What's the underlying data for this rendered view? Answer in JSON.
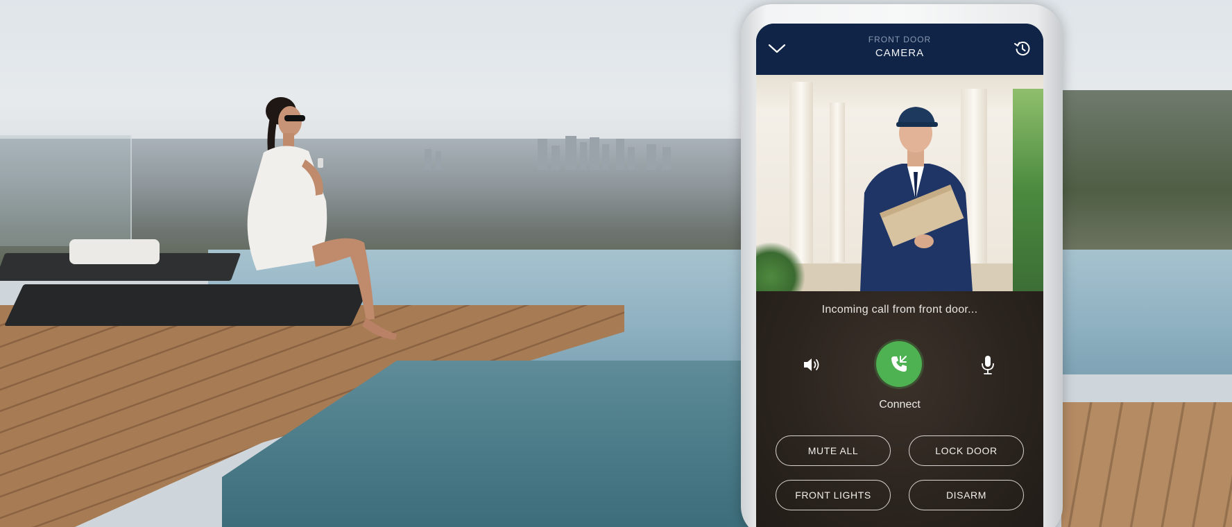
{
  "header": {
    "subtitle": "FRONT DOOR",
    "title": "CAMERA",
    "back_icon": "chevron-down-icon",
    "history_icon": "history-icon"
  },
  "call": {
    "status_text": "Incoming call from front door...",
    "connect_label": "Connect",
    "speaker_icon": "speaker-icon",
    "mic_icon": "microphone-icon",
    "connect_icon": "phone-answer-icon"
  },
  "actions": [
    {
      "label": "MUTE ALL"
    },
    {
      "label": "LOCK DOOR"
    },
    {
      "label": "FRONT LIGHTS"
    },
    {
      "label": "DISARM"
    }
  ],
  "colors": {
    "header_bg": "#0f2447",
    "connect_green": "#4fb252",
    "panel_bg": "#2b241e"
  }
}
